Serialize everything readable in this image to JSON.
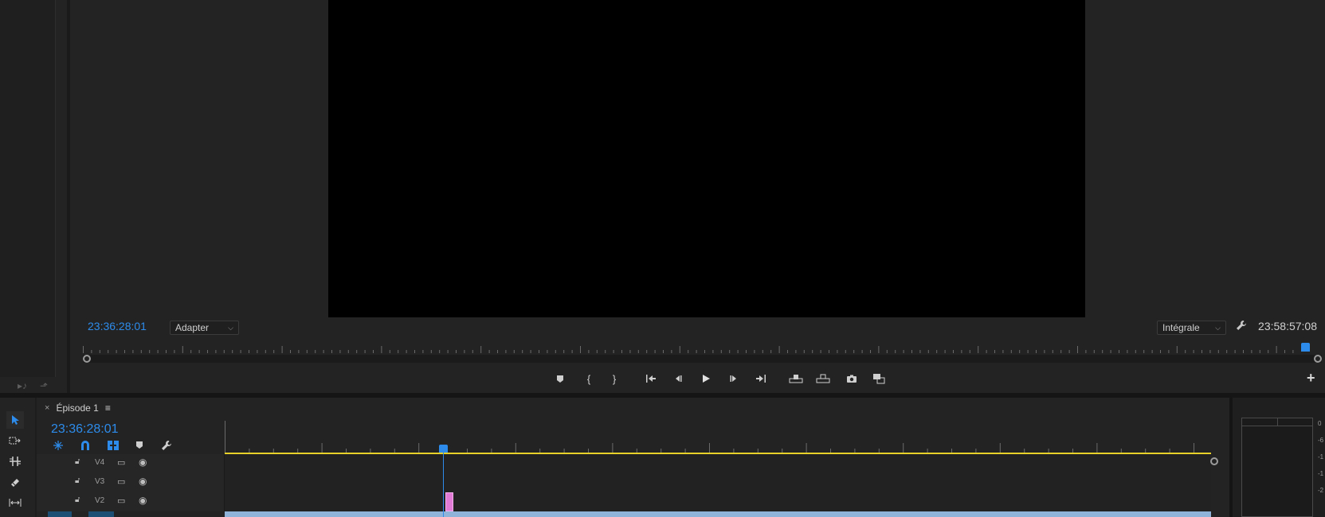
{
  "monitor": {
    "timecode_current": "23:36:28:01",
    "timecode_duration": "23:58:57:08",
    "zoom_label": "Adapter",
    "quality_label": "Intégrale"
  },
  "timeline": {
    "sequence_name": "Épisode 1",
    "timecode": "23:36:28:01",
    "tracks": [
      {
        "name": "V4"
      },
      {
        "name": "V3"
      },
      {
        "name": "V2"
      }
    ]
  },
  "meters": {
    "scale": [
      "0",
      "-6",
      "-1",
      "-1",
      "-2"
    ]
  },
  "colors": {
    "accent": "#2d8ceb",
    "work_area": "#e8d22a",
    "clip_pink": "#e07ad6",
    "video_track_v1": "#8fb3d9"
  },
  "icons": {
    "transport": [
      "marker-icon",
      "mark-in-icon",
      "mark-out-icon",
      "go-to-in-icon",
      "step-back-icon",
      "play-icon",
      "step-forward-icon",
      "go-to-out-icon",
      "lift-icon",
      "extract-icon",
      "camera-icon",
      "compare-icon"
    ]
  }
}
